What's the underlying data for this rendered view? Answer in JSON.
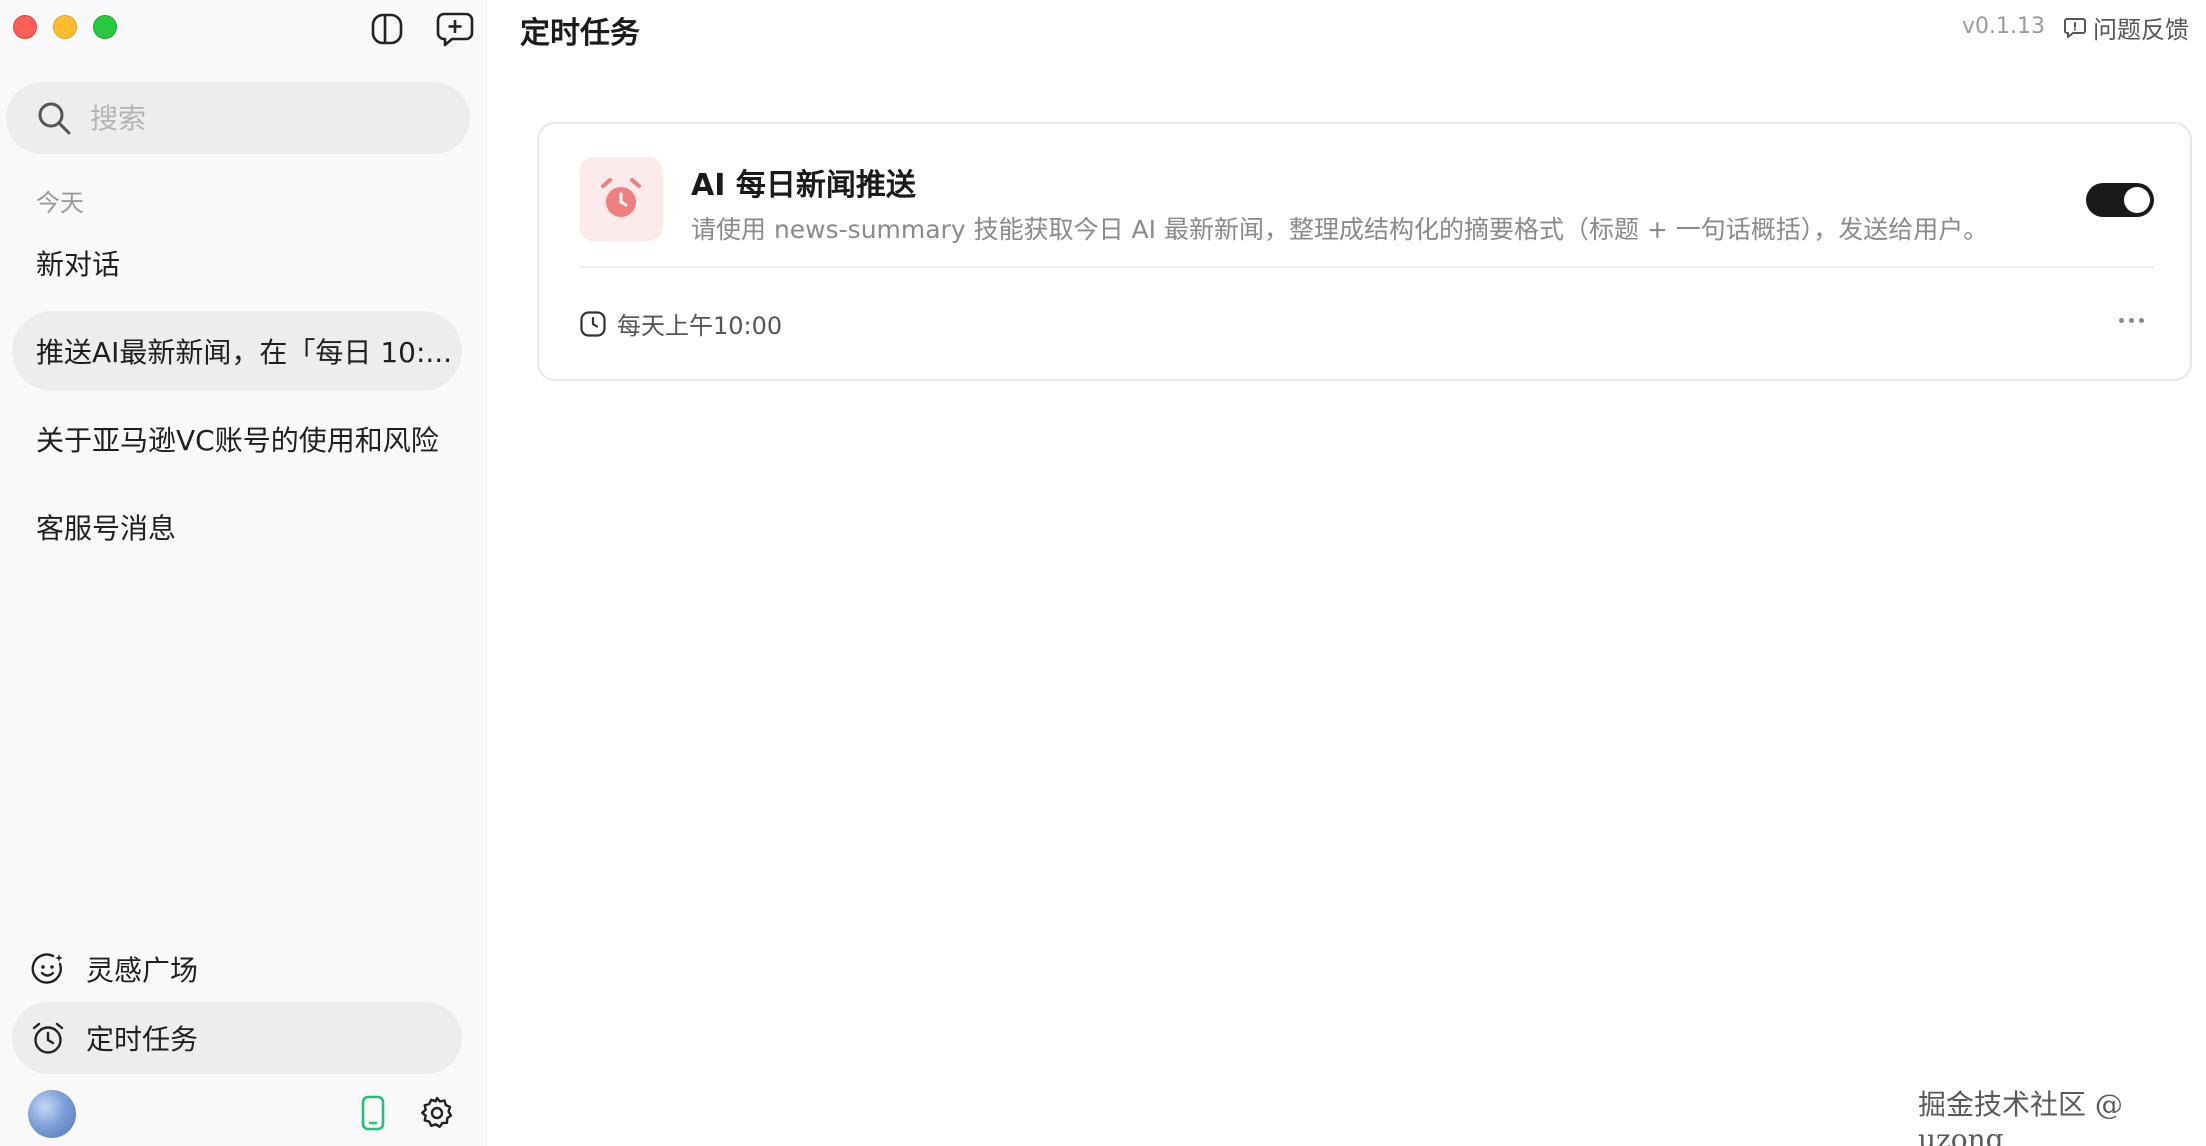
{
  "window": {
    "controls": [
      "close",
      "minimize",
      "maximize"
    ]
  },
  "sidebar": {
    "toggle_icon": "sidebar-toggle-icon",
    "new_chat_icon": "new-chat-icon",
    "search": {
      "placeholder": "搜索",
      "value": ""
    },
    "section_label": "今天",
    "conversations": [
      {
        "label": "新对话",
        "active": false
      },
      {
        "label": "推送AI最新新闻，在「每日 10:...",
        "active": true
      },
      {
        "label": "关于亚马逊VC账号的使用和风险",
        "active": false
      },
      {
        "label": "客服号消息",
        "active": false
      }
    ],
    "nav": [
      {
        "label": "灵感广场",
        "icon": "inspiration-smiley-icon",
        "active": false
      },
      {
        "label": "定时任务",
        "icon": "alarm-clock-icon",
        "active": true
      }
    ],
    "bottom_icons": [
      "avatar",
      "phone-icon",
      "settings-gear-icon"
    ]
  },
  "header": {
    "title": "定时任务",
    "version": "v0.1.13",
    "feedback_label": "问题反馈"
  },
  "task": {
    "title": "AI 每日新闻推送",
    "description": "请使用 news-summary 技能获取今日 AI 最新新闻，整理成结构化的摘要格式（标题 + 一句话概括），发送给用户。",
    "enabled": true,
    "schedule": "每天上午10:00",
    "icon": "alarm-clock-icon"
  },
  "watermark": "掘金技术社区 @ uzong",
  "colors": {
    "sidebar_bg": "#f9f9f9",
    "active_bg": "#ededed",
    "toggle_on": "#1a1a1a",
    "task_icon_bg": "#fdeaea",
    "task_icon_fg": "#f07f7f",
    "phone_icon": "#22c07a"
  }
}
